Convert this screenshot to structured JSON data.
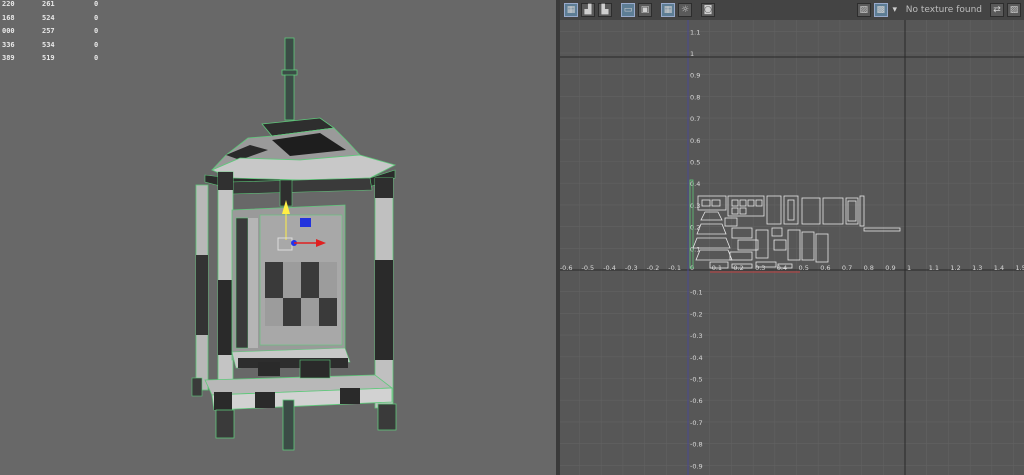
{
  "viewport": {
    "stats": [
      {
        "a": "220",
        "b": "261",
        "c": "0"
      },
      {
        "a": "168",
        "b": "524",
        "c": "0"
      },
      {
        "a": "000",
        "b": "257",
        "c": "0"
      },
      {
        "a": "336",
        "b": "534",
        "c": "0"
      },
      {
        "a": "389",
        "b": "519",
        "c": "0"
      }
    ]
  },
  "uv_editor": {
    "no_texture": "No texture found",
    "toolbar_icons": [
      "uv-snapshot-icon",
      "uv-grid-stairs-icon",
      "uv-grid-stairs-2-icon",
      "uv-frame-icon",
      "uv-frame-2-icon",
      "uv-checker-grid-icon",
      "uv-sun-icon",
      "uv-camera-icon"
    ],
    "toolbar_right_icons": [
      "image-icon",
      "checker-icon",
      "dropdown-icon",
      "texture-swap-icon",
      "image-2-icon"
    ],
    "x_ticks": [
      "-0.6",
      "-0.5",
      "-0.4",
      "-0.3",
      "-0.2",
      "-0.1",
      "0",
      "0.1",
      "0.2",
      "0.3",
      "0.4",
      "0.5",
      "0.6",
      "0.7",
      "0.8",
      "0.9",
      "1",
      "1.1",
      "1.2",
      "1.3",
      "1.4",
      "1.5"
    ],
    "y_ticks": [
      "1.1",
      "1",
      "0.9",
      "0.8",
      "0.7",
      "0.6",
      "0.5",
      "0.4",
      "0.3",
      "0.2",
      "0.1",
      "0",
      "-0.1",
      "-0.2",
      "-0.3",
      "-0.4",
      "-0.5",
      "-0.6",
      "-0.7",
      "-0.8",
      "-0.9"
    ],
    "colors": {
      "grid": "#626262",
      "axis": "#2a2a2a",
      "uv_shell": "#e6e6e6",
      "v_axis": "#4a4a90",
      "selection": "#5ec97a"
    }
  }
}
